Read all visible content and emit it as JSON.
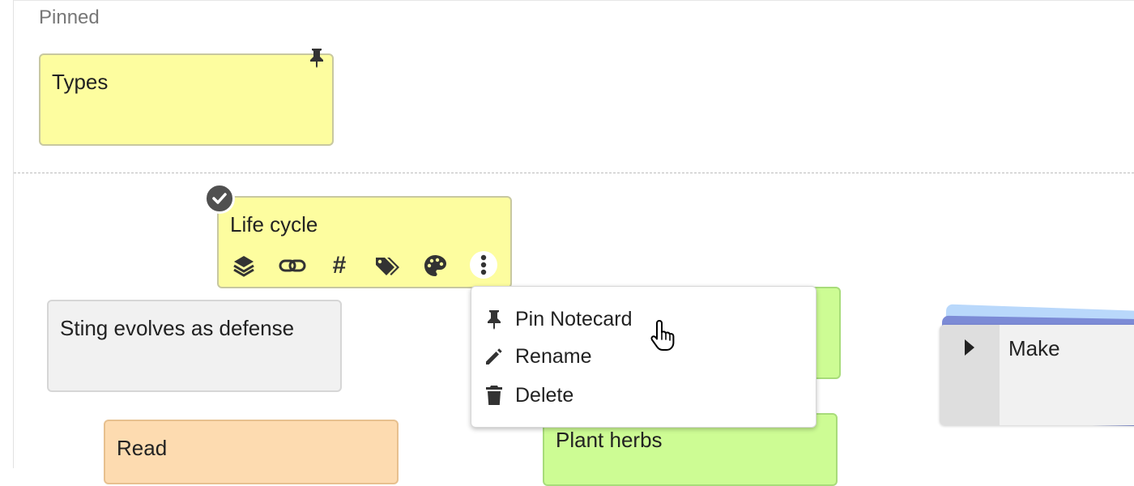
{
  "sections": {
    "pinned_label": "Pinned"
  },
  "cards": {
    "types": {
      "title": "Types",
      "color": "#fdfd9f"
    },
    "life_cycle": {
      "title": "Life cycle",
      "color": "#fdfd9f"
    },
    "sting": {
      "title": "Sting evolves as defense",
      "color": "#f1f1f1"
    },
    "read": {
      "title": "Read",
      "color": "#fddbb0"
    },
    "plant_herbs": {
      "title": "Plant herbs",
      "color": "#cdfc94"
    },
    "hidden_green": {
      "color": "#cdfc94"
    }
  },
  "toolbar_icons": [
    "layers-icon",
    "link-icon",
    "hash-icon",
    "tags-icon",
    "palette-icon",
    "more-vert-icon"
  ],
  "toolbar": {
    "hash_glyph": "#"
  },
  "context_menu": {
    "items": [
      {
        "label": "Pin Notecard",
        "icon": "pin-icon"
      },
      {
        "label": "Rename",
        "icon": "pencil-icon"
      },
      {
        "label": "Delete",
        "icon": "trash-icon"
      }
    ]
  },
  "stack": {
    "title": "Make",
    "colors": [
      "#b9d8fb",
      "#7c8bd6",
      "#f1f1f1"
    ]
  }
}
